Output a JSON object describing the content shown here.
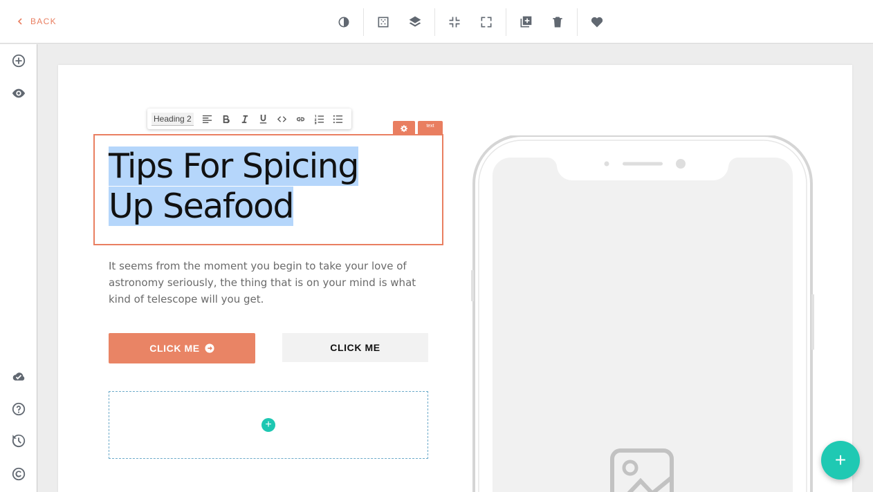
{
  "topbar": {
    "back_label": "BACK",
    "tools": [
      "contrast-icon",
      "grid-icon",
      "layers-icon",
      "collapse-icon",
      "expand-icon",
      "duplicate-icon",
      "trash-icon",
      "heart-icon"
    ]
  },
  "sidebar": {
    "top_icons": [
      "add-circle-icon",
      "eye-icon"
    ],
    "bottom_icons": [
      "cloud-check-icon",
      "help-icon",
      "history-icon",
      "copyright-icon"
    ]
  },
  "editor_toolbar": {
    "heading_select": "Heading 2",
    "buttons": [
      "align-left",
      "bold",
      "italic",
      "underline",
      "code",
      "link",
      "ordered-list",
      "bullet-list"
    ]
  },
  "element_badge": {
    "type_label": "text"
  },
  "content": {
    "heading_line1": "Tips For Spicing",
    "heading_line2": "Up Seafood",
    "paragraph": "It seems from the moment you begin to take your love of astronomy seriously, the thing that is on your mind is what kind of telescope will you get.",
    "button_primary": "CLICK ME",
    "button_secondary": "CLICK ME"
  },
  "colors": {
    "accent": "#e97e60",
    "teal": "#1fc9b3",
    "selection": "#b5d6fb",
    "icon_gray": "#616871"
  }
}
